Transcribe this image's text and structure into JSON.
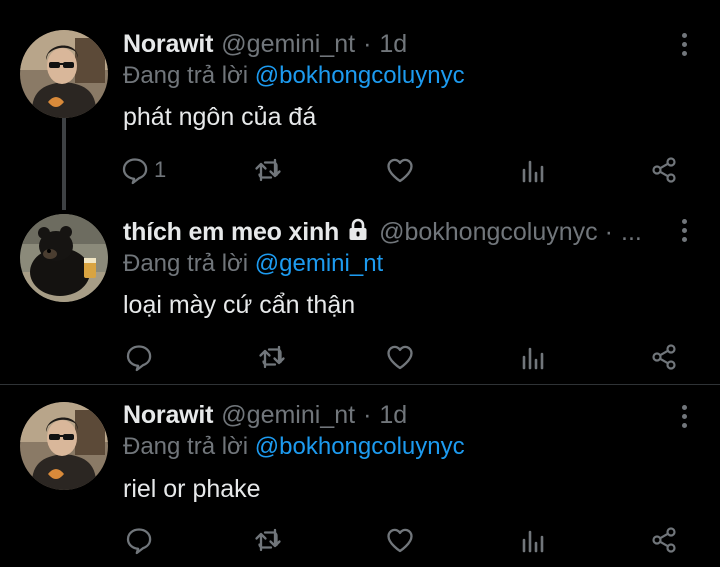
{
  "colors": {
    "background": "#000000",
    "text_primary": "#e7e9ea",
    "text_secondary": "#71767b",
    "mention": "#1d9bf0",
    "divider": "#2f3336",
    "thread_line": "#3e4144"
  },
  "tweets": [
    {
      "name": "Norawit",
      "handle": "@gemini_nt",
      "separator": "·",
      "time": "1d",
      "reply_prefix": "Đang trả lời",
      "reply_to": "@bokhongcoluynyc",
      "text": "phát ngôn của đá",
      "reply_count": "1",
      "avatar": "profile-photo-man-with-sunglasses"
    },
    {
      "name": "thích em meo xinh",
      "locked": true,
      "handle": "@bokhongcoluynyc",
      "separator": "·",
      "time": "...",
      "reply_prefix": "Đang trả lời",
      "reply_to": "@gemini_nt",
      "text": "loại mày cứ cẩn thận",
      "reply_count": "",
      "avatar": "profile-photo-black-bear"
    },
    {
      "name": "Norawit",
      "handle": "@gemini_nt",
      "separator": "·",
      "time": "1d",
      "reply_prefix": "Đang trả lời",
      "reply_to": "@bokhongcoluynyc",
      "text": "riel or phake",
      "reply_count": "",
      "avatar": "profile-photo-man-with-sunglasses"
    }
  ],
  "icons": {
    "reply": "speech-bubble-icon",
    "retweet": "retweet-icon",
    "like": "heart-icon",
    "analytics": "bar-chart-icon",
    "share": "share-icon",
    "more": "vertical-dots-icon",
    "lock": "lock-icon"
  }
}
